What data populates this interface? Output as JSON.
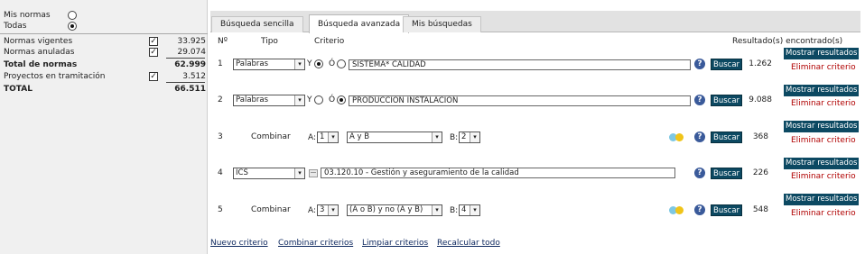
{
  "scope": {
    "mis_normas": "Mis normas",
    "todas": "Todas",
    "selected": "todas"
  },
  "stats": [
    {
      "label": "Normas vigentes",
      "value": "33.925",
      "checked": true
    },
    {
      "label": "Normas anuladas",
      "value": "29.074",
      "checked": true
    },
    {
      "label": "Total de normas",
      "value": "62.999",
      "bold": true
    },
    {
      "label": "Proyectos en tramitación",
      "value": "3.512",
      "checked": true
    },
    {
      "label": "TOTAL",
      "value": "66.511",
      "bold": true
    }
  ],
  "tabs": [
    {
      "label": "Búsqueda sencilla",
      "active": false
    },
    {
      "label": "Búsqueda avanzada",
      "active": true
    },
    {
      "label": "Mis búsquedas",
      "active": false
    }
  ],
  "headers": {
    "num": "Nº",
    "tipo": "Tipo",
    "criterio": "Criterio",
    "resultados": "Resultado(s) encontrado(s)"
  },
  "labels": {
    "y": "Y",
    "o": "Ó",
    "a": "A:",
    "b": "B:",
    "buscar": "Buscar",
    "mostrar": "Mostrar resultados",
    "eliminar": "Eliminar criterio",
    "help": "?",
    "arrow": "▾"
  },
  "criteria": [
    {
      "num": "1",
      "tipo": "Palabras",
      "logic": "y",
      "text": "SISTEMA* CALIDAD",
      "count": "1.262"
    },
    {
      "num": "2",
      "tipo": "Palabras",
      "logic": "o",
      "text": "PRODUCCION INSTALACION",
      "count": "9.088"
    },
    {
      "num": "3",
      "tipo": "Combinar",
      "a": "1",
      "op": "A y B",
      "b": "2",
      "count": "368"
    },
    {
      "num": "4",
      "tipo": "ICS",
      "text": "03.120.10 - Gestión y aseguramiento de la calidad",
      "count": "226"
    },
    {
      "num": "5",
      "tipo": "Combinar",
      "a": "3",
      "op": "(A o B) y no (A y B)",
      "b": "4",
      "count": "548"
    }
  ],
  "footer": {
    "nuevo": "Nuevo criterio",
    "combinar": "Combinar criterios",
    "limpiar": "Limpiar criterios",
    "recalcular": "Recalcular todo"
  },
  "colors": {
    "button_bg": "#0c4962",
    "delete_link": "#b00000",
    "help_icon": "#3a5a9a",
    "merge_a": "#7ec8e3",
    "merge_b": "#f0c419"
  }
}
